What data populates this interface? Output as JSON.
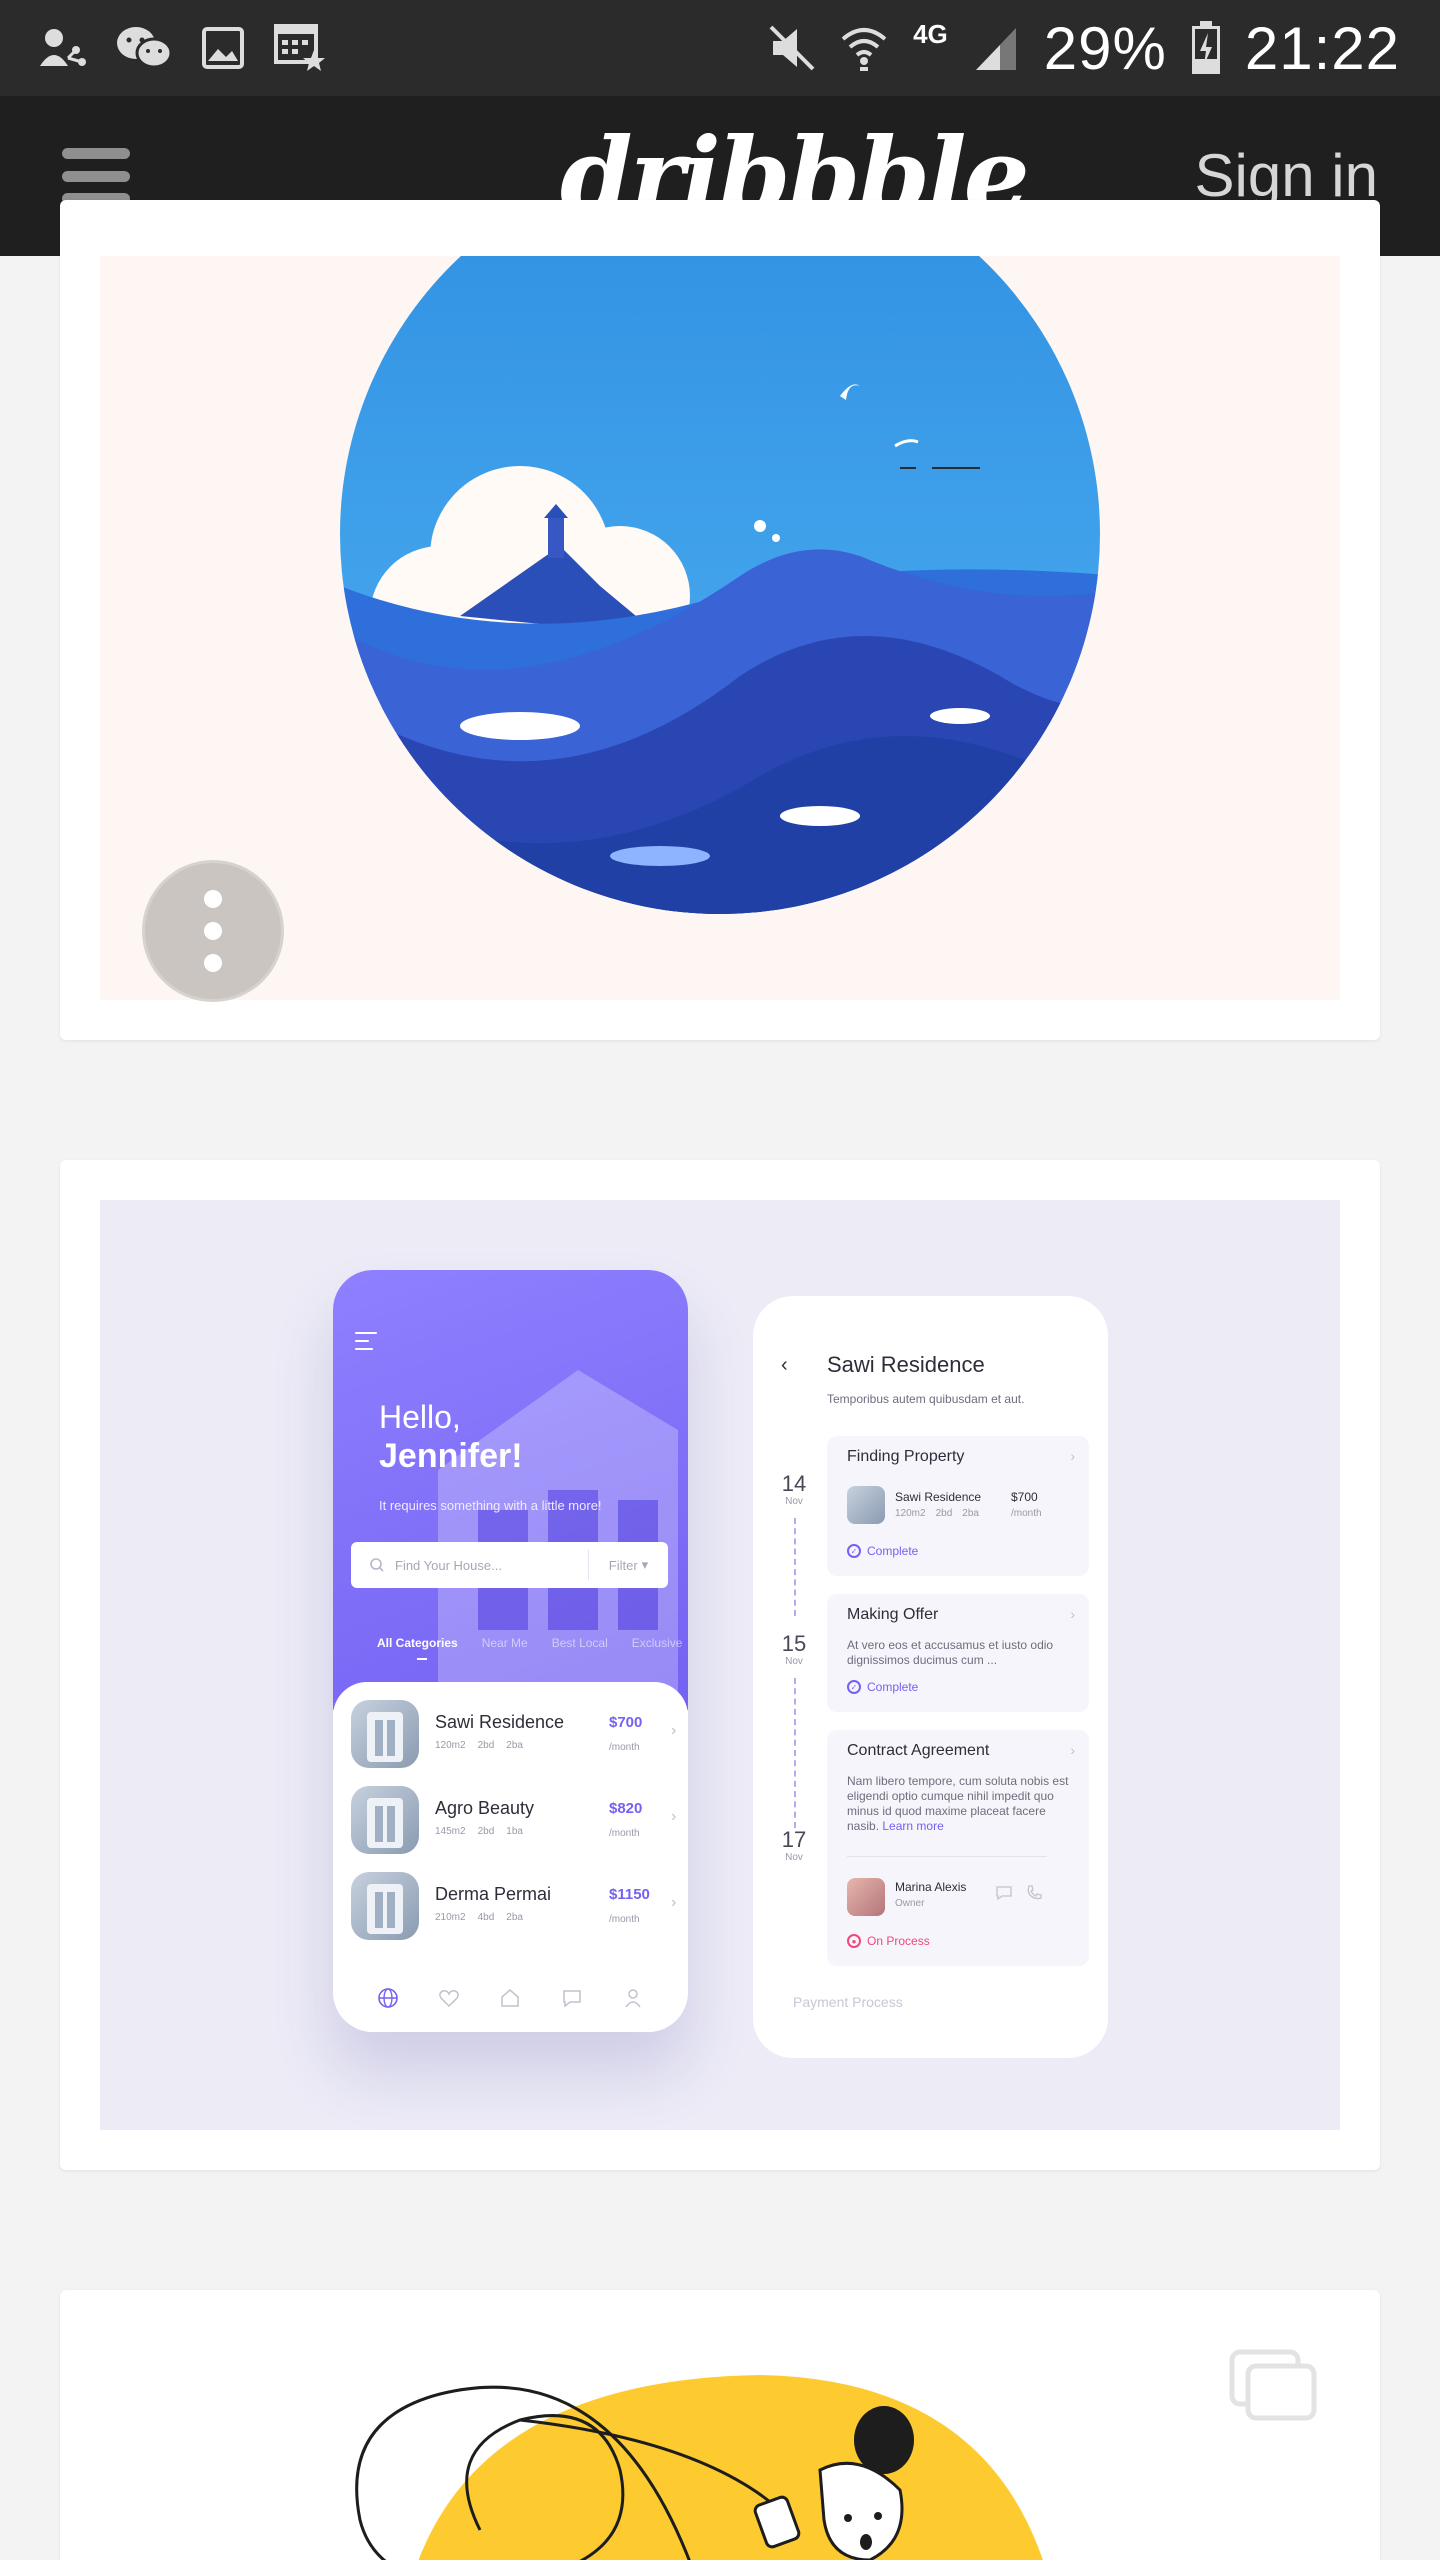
{
  "status_bar": {
    "network": "4G",
    "battery": "29%",
    "time": "21:22"
  },
  "header": {
    "logo": "dribbble",
    "sign_in": "Sign in"
  },
  "shot_app": {
    "greeting": "Hello,",
    "name": "Jennifer!",
    "subtitle": "It requires something with a little more!",
    "search_placeholder": "Find Your House...",
    "filter_label": "Filter",
    "tabs": [
      "All Categories",
      "Near Me",
      "Best Local",
      "Exclusive"
    ],
    "listings": [
      {
        "name": "Sawi Residence",
        "area": "120m2",
        "beds": "2bd",
        "baths": "2ba",
        "price": "$700",
        "per": "/month"
      },
      {
        "name": "Agro Beauty",
        "area": "145m2",
        "beds": "2bd",
        "baths": "1ba",
        "price": "$820",
        "per": "/month"
      },
      {
        "name": "Derma Permai",
        "area": "210m2",
        "beds": "4bd",
        "baths": "2ba",
        "price": "$1150",
        "per": "/month"
      }
    ]
  },
  "shot_detail": {
    "title": "Sawi Residence",
    "subtitle": "Temporibus autem quibusdam et aut.",
    "dates": [
      {
        "day": "14",
        "month": "Nov"
      },
      {
        "day": "15",
        "month": "Nov"
      },
      {
        "day": "17",
        "month": "Nov"
      }
    ],
    "steps": [
      {
        "title": "Finding Property",
        "item_name": "Sawi Residence",
        "item_area": "120m2",
        "item_beds": "2bd",
        "item_baths": "2ba",
        "item_price": "$700",
        "item_per": "/month",
        "status": "Complete"
      },
      {
        "title": "Making Offer",
        "text": "At vero eos et accusamus et iusto odio dignissimos ducimus cum ...",
        "status": "Complete"
      },
      {
        "title": "Contract Agreement",
        "text": "Nam libero tempore, cum soluta nobis est eligendi optio cumque nihil impedit quo minus id quod maxime placeat facere nasib.",
        "link": "Learn more",
        "owner_name": "Marina Alexis",
        "owner_role": "Owner",
        "status": "On Process"
      }
    ],
    "footer": "Payment Process"
  },
  "colors": {
    "accent": "#7462f2",
    "complete": "#7462f2",
    "on_process": "#f0487a",
    "status_bar_bg": "#2b2b2b",
    "header_bg": "#1f1f1f"
  },
  "icons": {
    "status_left": [
      "person-share-icon",
      "wechat-icon",
      "image-icon",
      "calendar-star-icon"
    ],
    "status_right": [
      "mute-icon",
      "wifi-icon",
      "signal-icon",
      "battery-charging-icon"
    ],
    "card_actions": "more-vertical-icon",
    "gallery": "multiple-shots-icon"
  }
}
